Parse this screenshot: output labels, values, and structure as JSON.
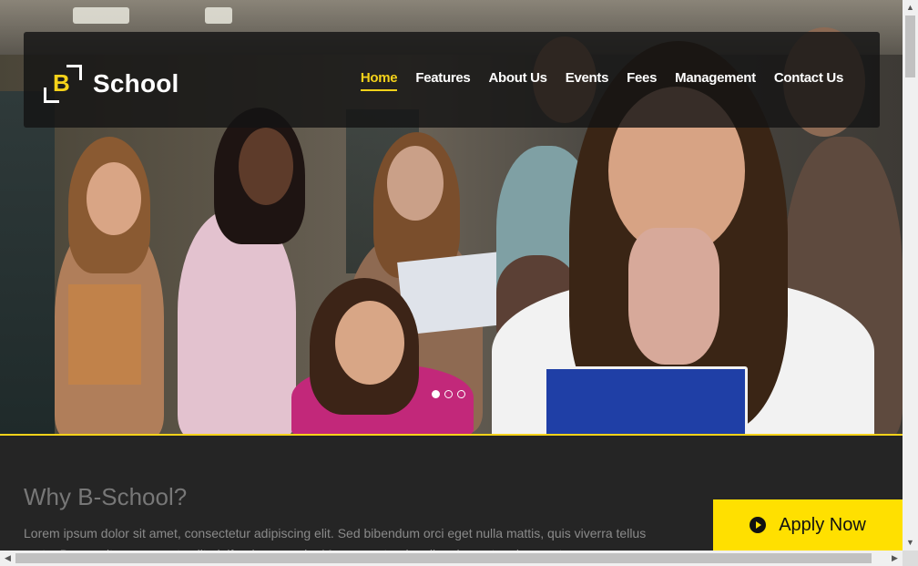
{
  "brand": {
    "logo_letter": "B",
    "name": "School",
    "accent": "#f5d21a"
  },
  "nav": {
    "items": [
      {
        "label": "Home",
        "active": true
      },
      {
        "label": "Features",
        "active": false
      },
      {
        "label": "About Us",
        "active": false
      },
      {
        "label": "Events",
        "active": false
      },
      {
        "label": "Fees",
        "active": false
      },
      {
        "label": "Management",
        "active": false
      },
      {
        "label": "Contact Us",
        "active": false
      }
    ]
  },
  "hero": {
    "slides_count": 3,
    "active_slide": 1
  },
  "section": {
    "title": "Why B-School?",
    "text": "Lorem ipsum dolor sit amet, consectetur adipiscing elit. Sed bibendum orci eget nulla mattis, quis viverra tellus porta. Donec vitae neque ut velit eleifend commodo. Maecenas turpis odio, placerat eu lorem ut"
  },
  "cta": {
    "label": "Apply Now",
    "icon": "play-circle-icon",
    "color": "#ffe000"
  },
  "scrollbar": {
    "up": "▲",
    "down": "▼",
    "left": "◀",
    "right": "▶"
  }
}
